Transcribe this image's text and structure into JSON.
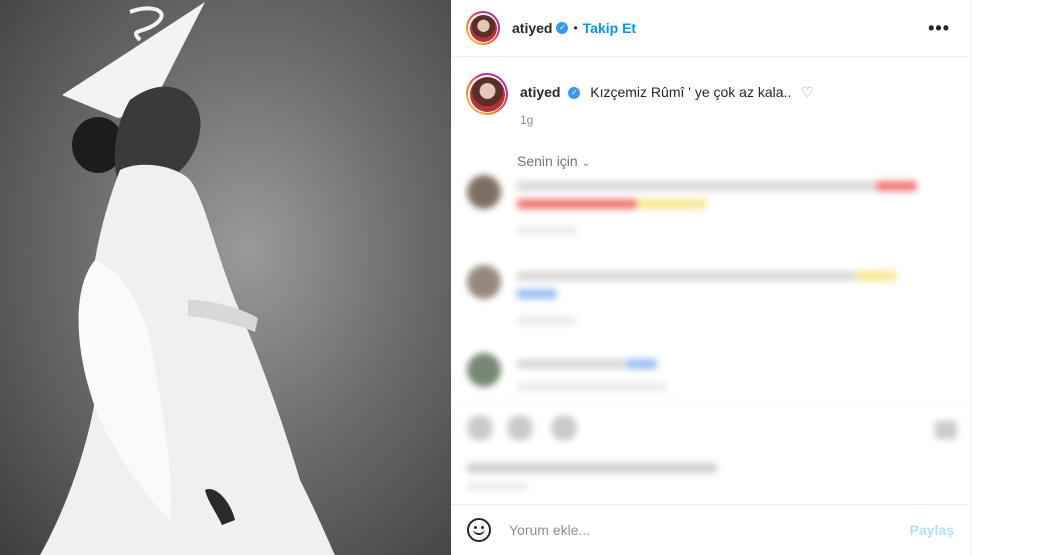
{
  "header": {
    "username": "atiyed",
    "separator": "•",
    "follow_label": "Takip Et",
    "more_label": "•••"
  },
  "caption": {
    "username": "atiyed",
    "text": "Kızçemiz Rûmî ' ye çok az kala..",
    "time": "1g"
  },
  "comments_filter": {
    "label": "Senin için",
    "chevron": "⌄"
  },
  "comment_box": {
    "placeholder": "Yorum ekle...",
    "post_label": "Paylaş"
  },
  "icons": {
    "verified": "verified-badge-icon",
    "heart": "heart-outline-icon",
    "emoji": "smile-icon",
    "chevron": "chevron-down-icon"
  },
  "colors": {
    "accent_blue": "#0095f6",
    "verified_blue": "#3897f0",
    "post_disabled": "#b2dffc",
    "muted_text": "#8e8e8e"
  }
}
